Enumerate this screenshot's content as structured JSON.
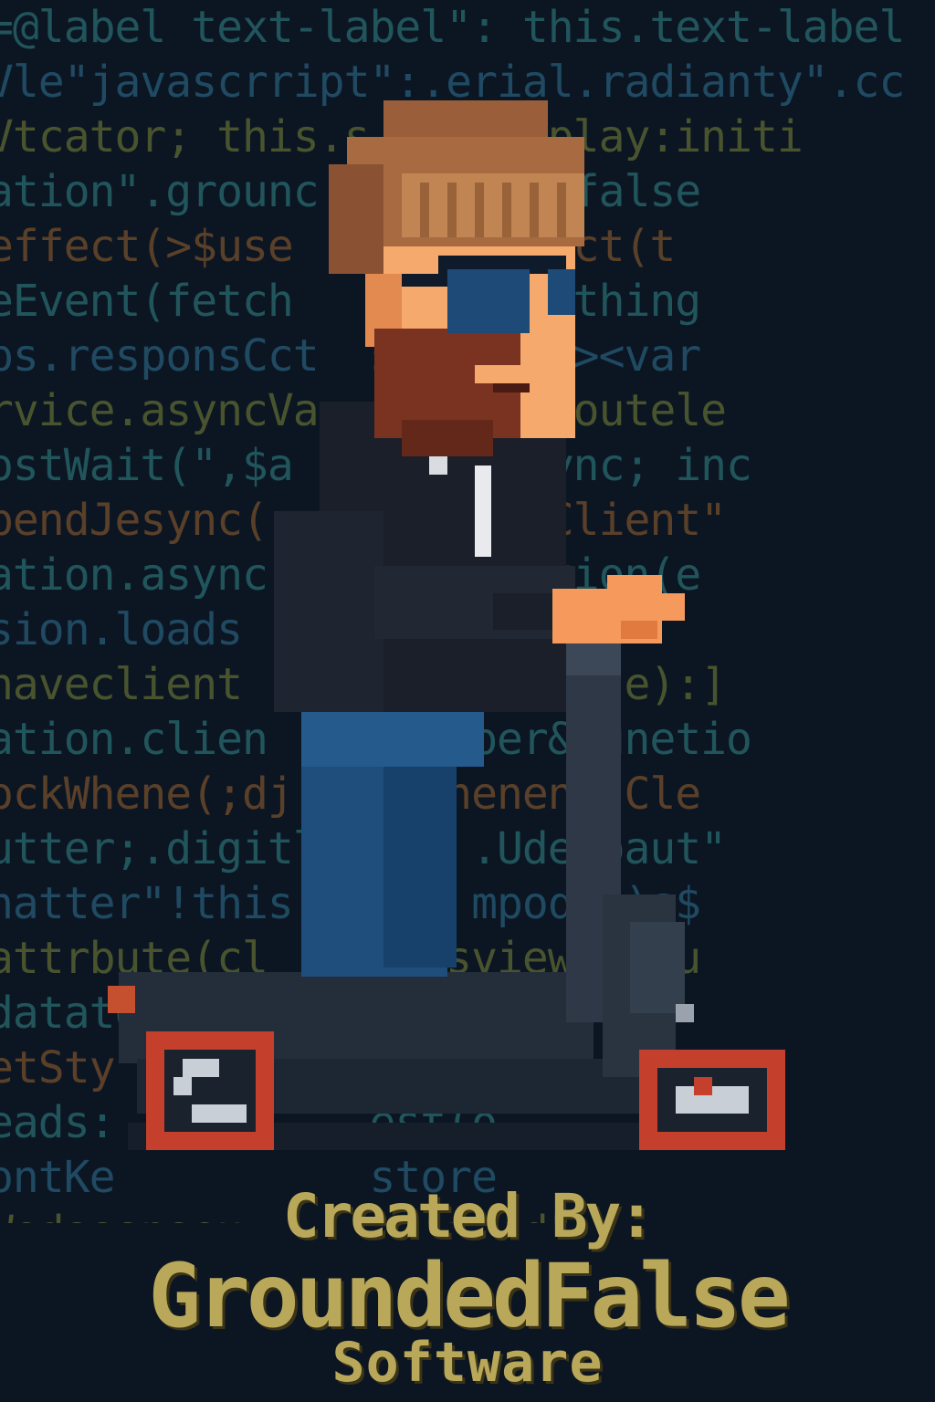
{
  "background_code_lines": [
    "=@label text-label\": this.text-label",
    "Vle\"javascrript\":.erial.radianty\".cc",
    "Vtcator; this.s  '.display:initi",
    "ation\".grounc  groundedfalse",
    "effect(>$use   cWsueffect(t",
    "eEvent(fetch   wber,onething",
    "ps.responsCct  seAssets><var",
    "rvice.asyncVa  .settimeoutele",
    "ostWait(\",$a  ; ioδ(async; inc",
    "pendJesync(   ent,\".seClient\"",
    "ation.async   ent(function(e",
    "sion.loads    rop(fect",
    "haveclient   act irte(case):]",
    "ation.clien  h(ex sper&funetio",
    "ockWhene(;dj isal nenentsCle",
    "utter;.digitl clie .UdeLoaut\"",
    "hatter\"!this  .sen mpoqe()s$",
    "attrbute(cl  deta sviewTribu",
    "datato    t  gler  sync(ti",
    "etSty          ionl\"",
    "eads:          est(o",
    "ontKe          store",
    "Wedooonoeu      eAnded\"."
  ],
  "colors": {
    "background": "#0c1623",
    "code_teal": "#2f7d80",
    "code_blue": "#2c6a8a",
    "code_olive": "#6f7a35",
    "code_orange": "#8a5a2c",
    "credit_text": "#b9a85a"
  },
  "character_icon": "pixel-art-bearded-man-on-electric-scooter",
  "credit": {
    "label": "Created By:",
    "name": "GroundedFalse",
    "subtitle": "Software"
  }
}
